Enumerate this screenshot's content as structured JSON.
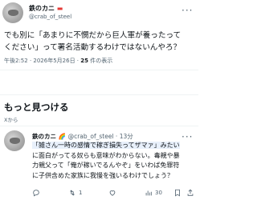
{
  "main_tweet": {
    "display_name": "鉄のカニ",
    "handle": "@crab_of_steel",
    "more": "···",
    "text_lines": [
      "でも別に「あまりに不憫だから巨人軍が養ったって",
      "ください」って署名活動するわけではないんやろ？"
    ],
    "time": "午後2:52 · 2026年5月26日 · ",
    "views_count": "25",
    "views_label": " 件の表示"
  },
  "discover": {
    "title": "もっと見つける",
    "subtitle": "Xから"
  },
  "rec_tweet": {
    "display_name": "鉄のカニ",
    "handle": "@crab_of_steel · 13分",
    "more": "···",
    "text_lines": [
      "「雑さん一時の感情で稼ぎ損失ってザマァ」みたい",
      "に面白がってる奴らも意味がわからない。毒親や暴",
      "力親父って「俺が稼いでるんやぞ」をいわば免罪符",
      "に子供含めた家族に我慢を強いるわけでしょう？"
    ],
    "actions": {
      "reply": "",
      "retweet": "1",
      "like": "",
      "views": "30"
    }
  },
  "colors": {
    "text": "#0f1419",
    "muted": "#536471",
    "highlight_bg": "#e8f0fb"
  }
}
